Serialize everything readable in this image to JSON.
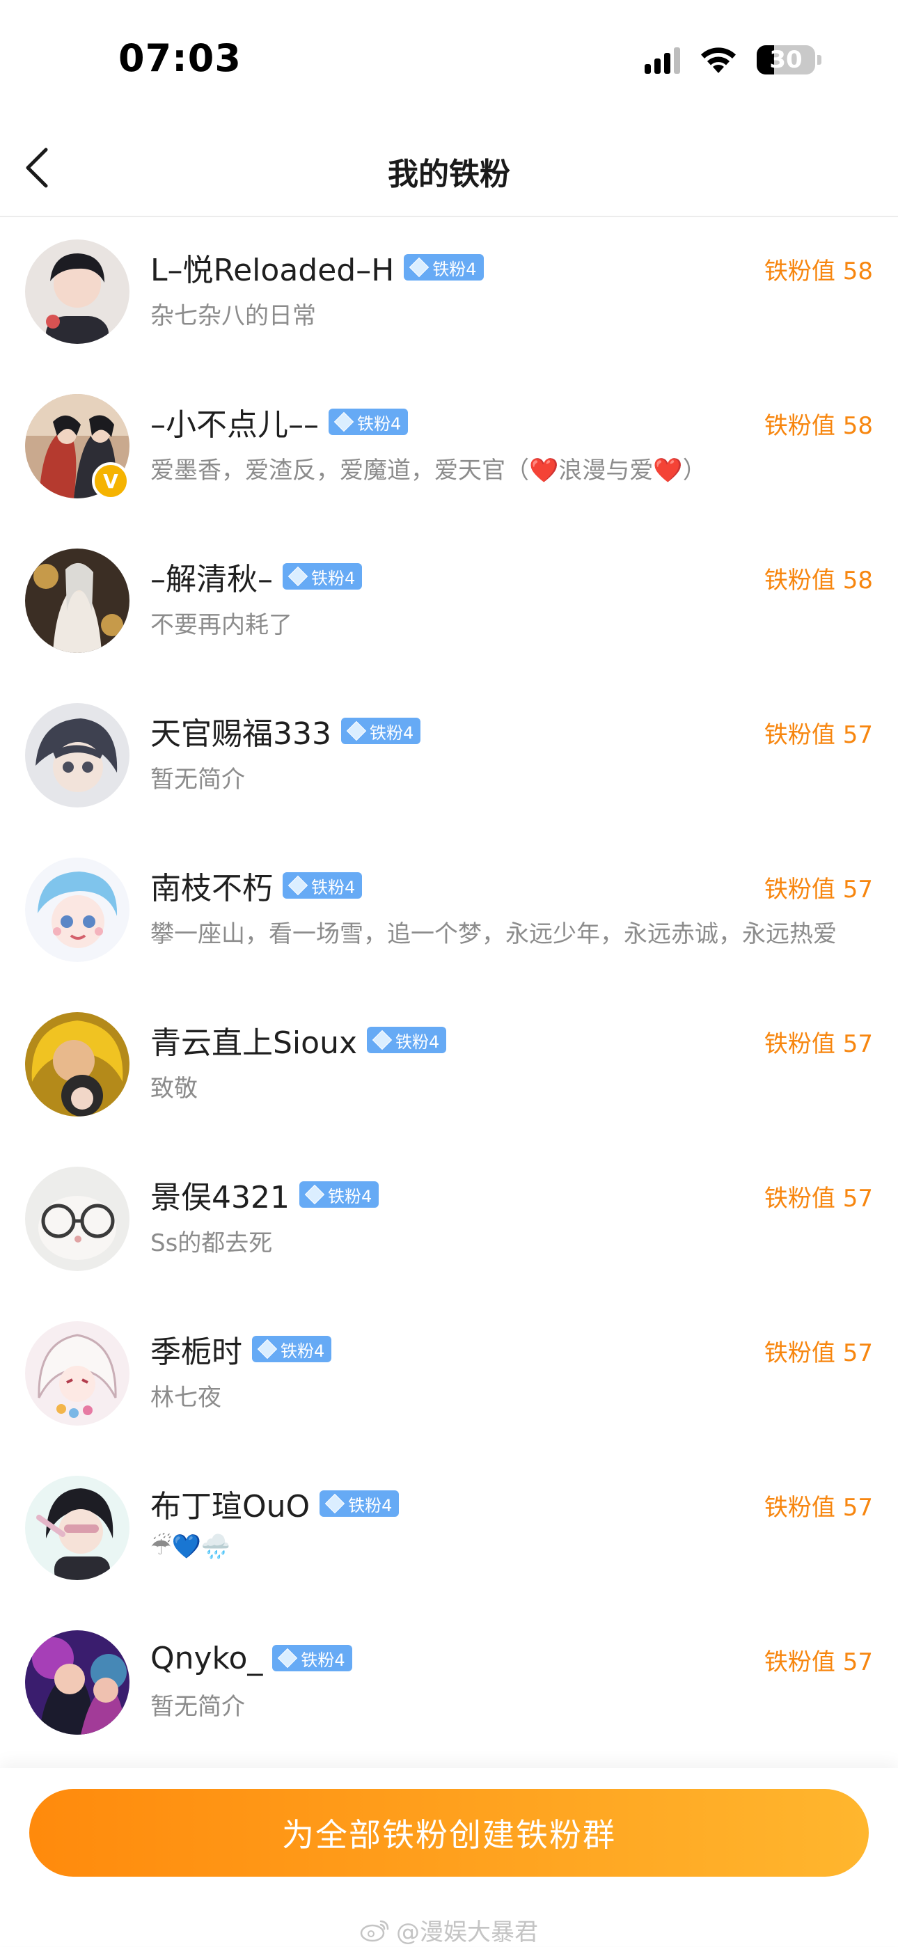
{
  "status_bar": {
    "time": "07:03",
    "battery": "30",
    "battery_level": 0.3
  },
  "header": {
    "title": "我的铁粉"
  },
  "fans": [
    {
      "name": "L–悦Reloaded–H",
      "level": "铁粉4",
      "bio": "杂七杂八的日常",
      "score_label": "铁粉值",
      "score": "58",
      "verified": false
    },
    {
      "name": "–小不点儿––",
      "level": "铁粉4",
      "bio": "爱墨香，爱渣反，爱魔道，爱天官（",
      "bio_heart_1": "❤️",
      "bio_mid": "浪漫与爱",
      "bio_heart_2": "❤️",
      "bio_end": "）",
      "score_label": "铁粉值",
      "score": "58",
      "verified": true,
      "verified_mark": "V"
    },
    {
      "name": "–解清秋–",
      "level": "铁粉4",
      "bio": "不要再内耗了",
      "score_label": "铁粉值",
      "score": "58",
      "verified": false
    },
    {
      "name": "天官赐福333",
      "level": "铁粉4",
      "bio": "暂无简介",
      "score_label": "铁粉值",
      "score": "57",
      "verified": false
    },
    {
      "name": "南枝不朽",
      "level": "铁粉4",
      "bio": "攀一座山，看一场雪，追一个梦，永远少年，永远赤诚，永远热爱",
      "score_label": "铁粉值",
      "score": "57",
      "verified": false
    },
    {
      "name": "青云直上Sioux",
      "level": "铁粉4",
      "bio": "致敬",
      "score_label": "铁粉值",
      "score": "57",
      "verified": false
    },
    {
      "name": "景俣4321",
      "level": "铁粉4",
      "bio": "Ss的都去死",
      "score_label": "铁粉值",
      "score": "57",
      "verified": false
    },
    {
      "name": "季栀时",
      "level": "铁粉4",
      "bio": "林七夜",
      "score_label": "铁粉值",
      "score": "57",
      "verified": false
    },
    {
      "name": "布丁瑄OuO",
      "level": "铁粉4",
      "bio": "☔💙🌧️",
      "score_label": "铁粉值",
      "score": "57",
      "verified": false
    },
    {
      "name": "Qnyko_",
      "level": "铁粉4",
      "bio": "暂无简介",
      "score_label": "铁粉值",
      "score": "57",
      "verified": false
    }
  ],
  "footer": {
    "button_label": "为全部铁粉创建铁粉群",
    "watermark": "@漫娱大暴君"
  },
  "colors": {
    "accent_orange": "#f7860f",
    "level_tag_blue": "#66aaf5",
    "button_gradient_start": "#ff8a0c",
    "button_gradient_end": "#ffb62e",
    "verified_gold": "#f5b301"
  }
}
